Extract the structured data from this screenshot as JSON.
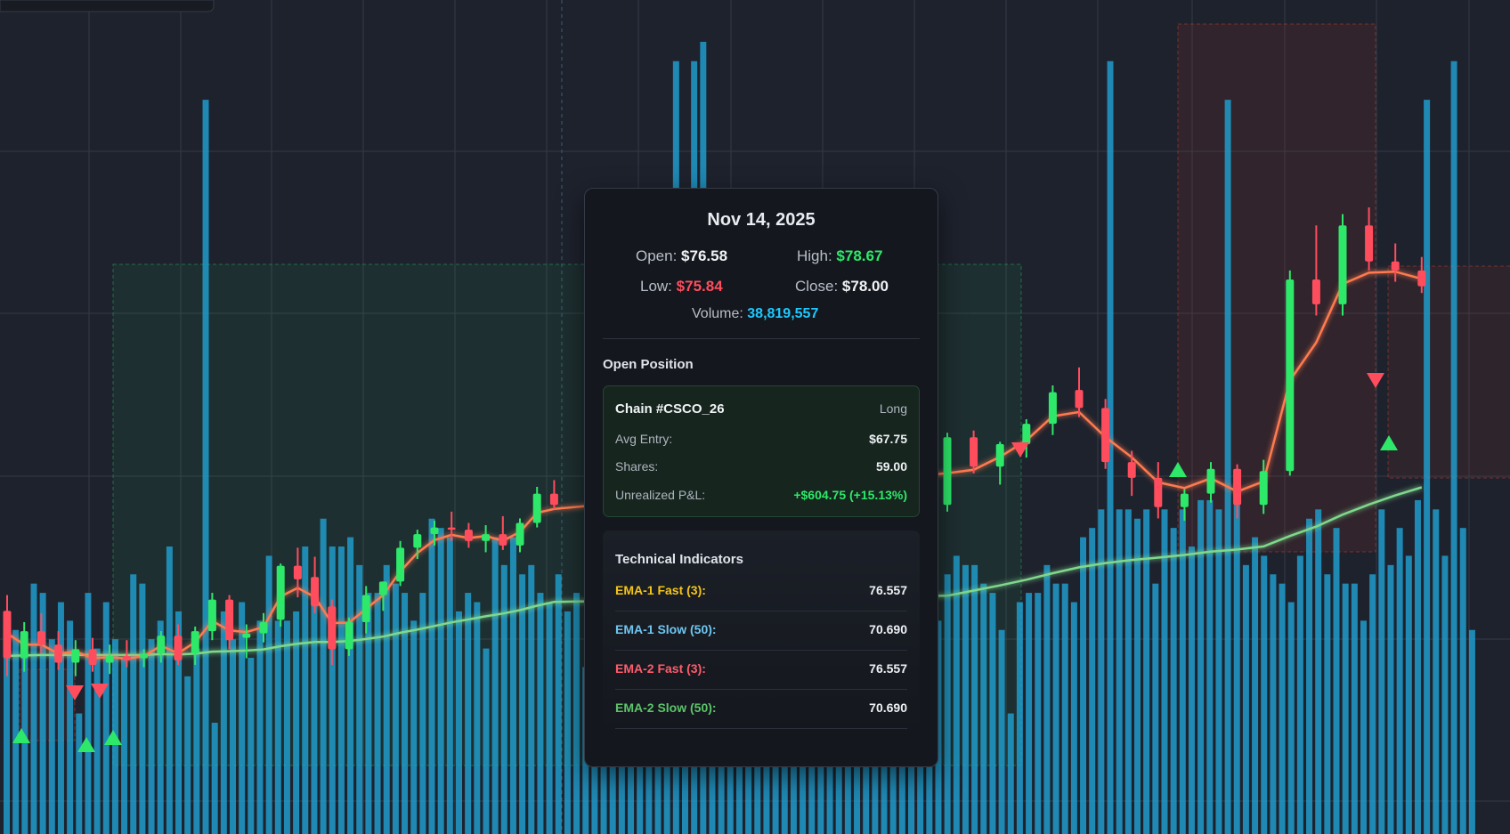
{
  "chart_data": {
    "type": "candlestick",
    "symbol": "CSCO",
    "candles": [
      [
        77.9,
        78.6,
        75.0,
        75.8
      ],
      [
        75.8,
        77.4,
        75.2,
        77.0
      ],
      [
        77.0,
        77.8,
        76.0,
        76.4
      ],
      [
        76.4,
        77.0,
        75.3,
        75.6
      ],
      [
        75.6,
        76.6,
        75.0,
        76.2
      ],
      [
        76.2,
        76.7,
        75.2,
        75.5
      ],
      [
        75.6,
        76.4,
        75.1,
        75.9
      ],
      [
        75.9,
        76.6,
        75.4,
        75.7
      ],
      [
        75.8,
        76.2,
        75.4,
        76.0
      ],
      [
        76.0,
        77.0,
        75.6,
        76.8
      ],
      [
        76.8,
        77.3,
        75.5,
        75.7
      ],
      [
        76.0,
        77.2,
        75.5,
        77.0
      ],
      [
        77.0,
        78.7,
        76.6,
        78.4
      ],
      [
        78.4,
        78.6,
        76.2,
        76.6
      ],
      [
        76.7,
        77.3,
        75.8,
        76.9
      ],
      [
        76.9,
        77.8,
        76.5,
        77.4
      ],
      [
        77.5,
        80.0,
        77.2,
        79.9
      ],
      [
        79.9,
        80.7,
        78.5,
        79.3
      ],
      [
        79.4,
        80.3,
        77.8,
        78.1
      ],
      [
        78.1,
        78.4,
        75.5,
        76.2
      ],
      [
        76.2,
        77.6,
        75.9,
        77.4
      ],
      [
        77.4,
        79.0,
        76.9,
        78.6
      ],
      [
        78.6,
        79.2,
        77.9,
        79.2
      ],
      [
        79.2,
        81.0,
        79.0,
        80.7
      ],
      [
        80.7,
        81.5,
        80.2,
        81.3
      ],
      [
        81.3,
        81.9,
        80.8,
        81.6
      ],
      [
        81.6,
        82.3,
        81.0,
        81.5
      ],
      [
        81.5,
        81.8,
        80.7,
        81.0
      ],
      [
        81.0,
        81.7,
        80.5,
        81.3
      ],
      [
        81.3,
        82.1,
        80.6,
        80.8
      ],
      [
        80.8,
        82.0,
        80.5,
        81.8
      ],
      [
        81.8,
        83.4,
        81.6,
        83.1
      ],
      [
        83.1,
        83.7,
        82.4,
        82.6
      ],
      [
        82.6,
        85.8,
        82.3,
        85.6
      ],
      [
        85.6,
        85.9,
        84.0,
        84.3
      ],
      [
        84.3,
        85.4,
        83.5,
        85.3
      ],
      [
        85.3,
        86.4,
        84.7,
        86.2
      ],
      [
        86.2,
        87.9,
        85.7,
        87.6
      ],
      [
        87.7,
        88.7,
        86.5,
        86.9
      ],
      [
        86.9,
        87.3,
        84.2,
        84.5
      ],
      [
        84.5,
        85.0,
        83.0,
        83.8
      ],
      [
        83.8,
        84.5,
        82.0,
        82.5
      ],
      [
        82.5,
        83.3,
        81.9,
        83.1
      ],
      [
        83.1,
        84.5,
        82.7,
        84.2
      ],
      [
        84.2,
        84.4,
        82.0,
        82.6
      ],
      [
        82.6,
        84.6,
        82.2,
        84.1
      ],
      [
        84.1,
        93.0,
        83.9,
        92.6
      ],
      [
        92.6,
        95.0,
        91.0,
        91.5
      ],
      [
        91.5,
        95.5,
        91.0,
        95.0
      ],
      [
        95.0,
        95.8,
        93.0,
        93.4
      ],
      [
        93.4,
        94.2,
        92.5,
        93.0
      ],
      [
        93.0,
        93.6,
        92.0,
        92.3
      ]
    ],
    "volume": [
      23,
      22,
      19,
      27,
      26,
      21,
      25,
      23,
      13,
      26,
      20,
      25,
      21,
      19,
      28,
      27,
      21,
      23,
      31,
      24,
      17,
      20,
      38,
      12,
      24,
      21,
      25,
      19,
      23,
      30,
      23,
      23,
      24,
      31,
      26,
      34,
      31,
      31,
      32,
      29,
      26,
      26,
      29,
      27,
      26,
      23,
      26,
      34,
      33,
      32,
      24,
      26,
      25,
      20,
      32,
      29,
      32,
      28,
      29,
      26,
      25,
      28,
      24,
      26,
      18,
      27,
      27,
      24,
      26,
      34,
      35,
      31,
      32,
      30,
      40,
      26,
      40,
      41,
      23,
      20,
      19,
      24,
      25,
      22,
      33,
      34,
      31,
      27,
      34,
      32,
      32,
      31,
      35,
      25,
      27,
      25,
      25,
      24,
      28,
      31,
      29,
      28,
      23,
      23,
      28,
      30,
      29,
      29,
      27,
      26,
      22,
      13,
      25,
      26,
      26,
      29,
      27,
      27,
      25,
      32,
      33,
      35,
      40,
      35,
      35,
      34,
      35,
      27,
      35,
      33,
      35,
      31,
      36,
      36,
      35,
      38,
      36,
      29,
      32,
      30,
      28,
      27,
      25,
      30,
      34,
      35,
      28,
      33,
      27,
      27,
      23,
      28,
      35,
      29,
      33,
      30,
      36,
      38,
      35,
      30,
      40,
      33,
      22
    ],
    "ema_fast": [
      76.9,
      76.4,
      76.4,
      76.0,
      76.1,
      75.8,
      75.85,
      75.78,
      75.89,
      76.35,
      76.02,
      76.51,
      77.45,
      77.03,
      76.96,
      77.18,
      78.54,
      78.92,
      78.51,
      77.36,
      77.38,
      77.99,
      78.6,
      79.65,
      80.47,
      81.04,
      81.27,
      81.13,
      81.22,
      81.01,
      81.4,
      82.25,
      82.42,
      84.01,
      84.16,
      84.73,
      85.46,
      86.53,
      86.72,
      85.61,
      84.71,
      83.6,
      83.35,
      83.78,
      83.19,
      83.64,
      88.12,
      89.81,
      92.4,
      92.9,
      92.95,
      92.63
    ],
    "ema_slow": [
      75.9,
      75.92,
      75.94,
      75.94,
      75.95,
      75.94,
      75.94,
      75.94,
      75.95,
      75.98,
      75.97,
      76.0,
      76.09,
      76.11,
      76.14,
      76.19,
      76.33,
      76.44,
      76.52,
      76.52,
      76.56,
      76.65,
      76.76,
      76.93,
      77.07,
      77.23,
      77.39,
      77.52,
      77.66,
      77.78,
      77.93,
      78.13,
      78.3,
      78.57,
      78.8,
      79.03,
      79.28,
      79.57,
      79.83,
      80.02,
      80.16,
      80.26,
      80.38,
      80.53,
      80.62,
      80.76,
      81.22,
      81.64,
      82.17,
      82.62,
      83.02,
      83.38
    ]
  },
  "tooltip": {
    "date": "Nov 14, 2025",
    "open_label": "Open:",
    "open_value": "$76.58",
    "high_label": "High:",
    "high_value": "$78.67",
    "low_label": "Low:",
    "low_value": "$75.84",
    "close_label": "Close:",
    "close_value": "$78.00",
    "volume_label": "Volume:",
    "volume_value": "38,819,557",
    "position_section_title": "Open Position",
    "position": {
      "chain": "Chain #CSCO_26",
      "side": "Long",
      "avg_entry_label": "Avg Entry:",
      "avg_entry_value": "$67.75",
      "shares_label": "Shares:",
      "shares_value": "59.00",
      "pnl_label": "Unrealized P&L:",
      "pnl_value": "+$604.75 (+15.13%)"
    },
    "indicators_title": "Technical Indicators",
    "indicators": [
      {
        "label": "EMA-1 Fast (3):",
        "value": "76.557",
        "color": "#f5c518"
      },
      {
        "label": "EMA-1 Slow (50):",
        "value": "70.690",
        "color": "#6ec6f0"
      },
      {
        "label": "EMA-2 Fast (3):",
        "value": "76.557",
        "color": "#ff5c6c"
      },
      {
        "label": "EMA-2 Slow (50):",
        "value": "70.690",
        "color": "#5cc46a"
      }
    ]
  },
  "colors": {
    "background": "#1e222d",
    "grid": "#343946",
    "bull": "#2ee86a",
    "bear": "#ff4d5e",
    "volume": "#1fa2d4",
    "ema_fast": "#ff7a50",
    "ema_slow": "#7fd88c",
    "long_zone": "#26a65b",
    "short_zone": "#c0392b"
  }
}
